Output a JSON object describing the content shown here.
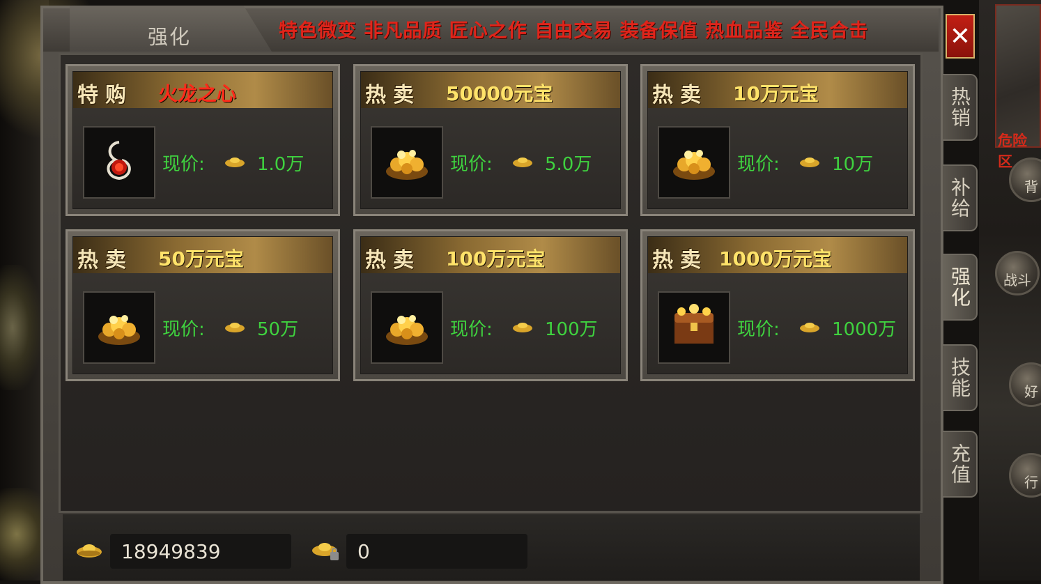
{
  "window": {
    "title": "强化",
    "marquee": "特色微变 非凡品质 匠心之作 自由交易 装备保值 热血品鉴 全民合击",
    "close_icon": "✕"
  },
  "products": [
    {
      "tag": "特购",
      "name": "火龙之心",
      "name_color": "red",
      "price_label": "现价:",
      "price": "1.0万",
      "icon": "fire-dragon-heart-icon"
    },
    {
      "tag": "热卖",
      "name": "50000元宝",
      "name_color": "yellow",
      "price_label": "现价:",
      "price": "5.0万",
      "icon": "gold-pile-icon"
    },
    {
      "tag": "热卖",
      "name": "10万元宝",
      "name_color": "yellow",
      "price_label": "现价:",
      "price": "10万",
      "icon": "gold-pile-icon"
    },
    {
      "tag": "热卖",
      "name": "50万元宝",
      "name_color": "yellow",
      "price_label": "现价:",
      "price": "50万",
      "icon": "gold-pile-icon"
    },
    {
      "tag": "热卖",
      "name": "100万元宝",
      "name_color": "yellow",
      "price_label": "现价:",
      "price": "100万",
      "icon": "gold-pile-icon"
    },
    {
      "tag": "热卖",
      "name": "1000万元宝",
      "name_color": "yellow",
      "price_label": "现价:",
      "price": "1000万",
      "icon": "treasure-chest-icon"
    }
  ],
  "currency": {
    "gold": "18949839",
    "bound_gold": "0"
  },
  "side_tabs": [
    {
      "label": "热销",
      "active": false
    },
    {
      "label": "补给",
      "active": false
    },
    {
      "label": "强化",
      "active": true
    },
    {
      "label": "技能",
      "active": false
    },
    {
      "label": "充值",
      "active": false
    }
  ],
  "background": {
    "danger_zone": "危险区",
    "buttons": [
      "背",
      "战斗",
      "好",
      "行"
    ]
  },
  "colors": {
    "price_green": "#3fd23f",
    "marquee_red": "#e0241a",
    "name_red": "#ff2a1a",
    "name_yellow": "#ffe36a"
  }
}
